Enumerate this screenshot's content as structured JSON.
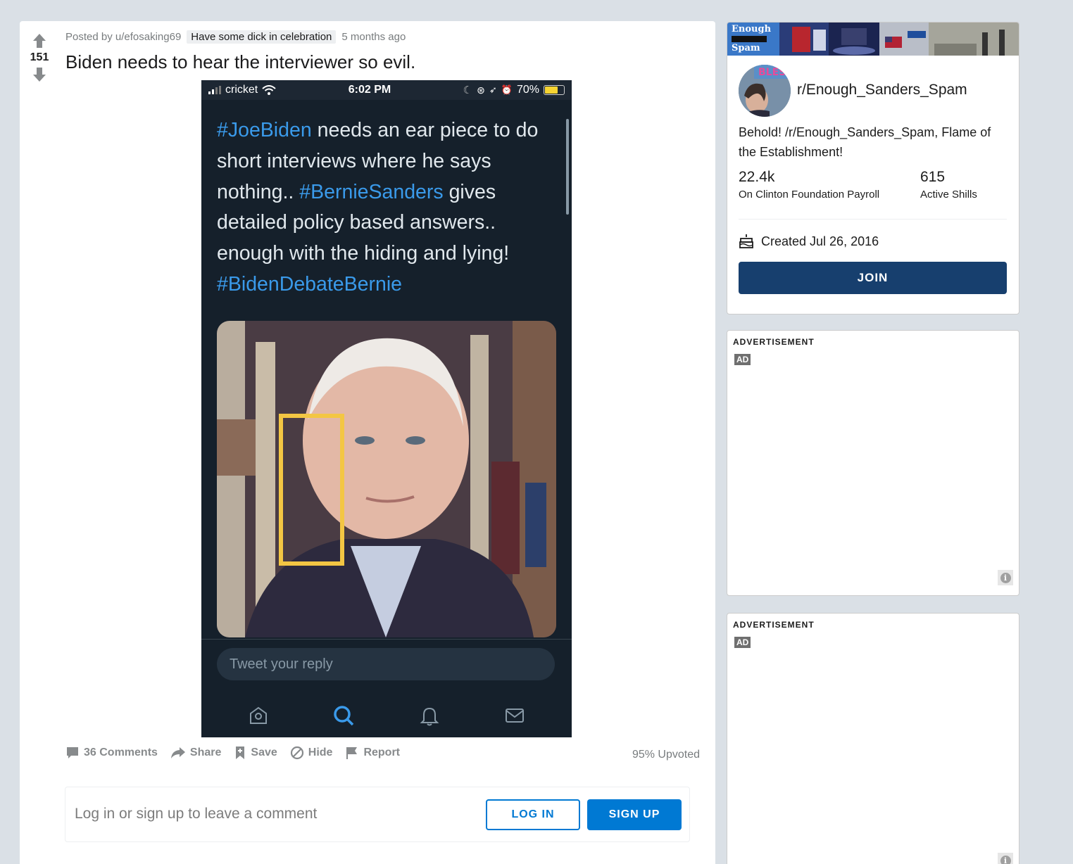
{
  "post": {
    "score": "151",
    "posted_by": "Posted by u/efosaking69",
    "flair": "Have some dick in celebration",
    "age": "5 months ago",
    "title": "Biden needs to hear the interviewer so evil.",
    "upvoted": "95% Upvoted"
  },
  "screenshot": {
    "carrier": "cricket",
    "time": "6:02 PM",
    "battery": "70%",
    "battery_level": 0.7,
    "tweet_segments": [
      {
        "text": "#JoeBiden",
        "tag": true
      },
      {
        "text": " needs an ear piece to do short interviews where he says nothing.. ",
        "tag": false
      },
      {
        "text": "#BernieSanders",
        "tag": true
      },
      {
        "text": " gives detailed policy based answers.. enough with the hiding and lying! ",
        "tag": false
      },
      {
        "text": "#BidenDebateBernie",
        "tag": true
      }
    ],
    "reply_placeholder": "Tweet your reply",
    "tab_icons": [
      "home-icon",
      "search-icon",
      "bell-icon",
      "mail-icon"
    ],
    "hashtag_color": "#3a9aea",
    "highlight_color": "#f3c643"
  },
  "actions": {
    "comments": "36 Comments",
    "share": "Share",
    "save": "Save",
    "hide": "Hide",
    "report": "Report"
  },
  "comment_box": {
    "prompt": "Log in or sign up to leave a comment",
    "login": "LOG IN",
    "signup": "SIGN UP"
  },
  "sidebar": {
    "banner_logo_top": "Enough",
    "banner_logo_bottom": "Spam",
    "avatar_text": "BLESS",
    "name": "r/Enough_Sanders_Spam",
    "description": "Behold! /r/Enough_Sanders_Spam, Flame of the Establishment!",
    "members": "22.4k",
    "members_label": "On Clinton Foundation Payroll",
    "online": "615",
    "online_label": "Active Shills",
    "created": "Created Jul 26, 2016",
    "join": "JOIN"
  },
  "ads": [
    {
      "title": "ADVERTISEMENT",
      "badge": "AD"
    },
    {
      "title": "ADVERTISEMENT",
      "badge": "AD"
    }
  ],
  "colors": {
    "accent": "#0079d3",
    "join": "#173f6e",
    "background": "#dae0e6"
  }
}
